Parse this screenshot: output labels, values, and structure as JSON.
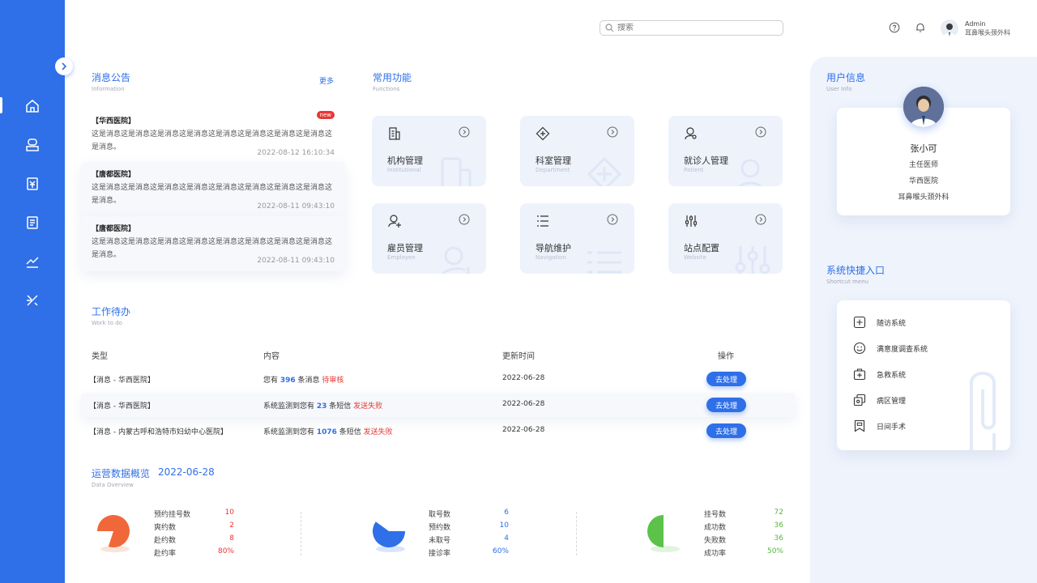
{
  "topbar": {
    "search_placeholder": "搜索",
    "admin_name": "Admin",
    "admin_dept": "耳鼻喉头颈外科"
  },
  "notices": {
    "title": "消息公告",
    "subtitle": "Information",
    "more": "更多",
    "items": [
      {
        "org": "【华西医院】",
        "body": "这是消息这是消息这是消息这是消息这是消息这是消息这是消息这是消息这是消息。",
        "time": "2022-08-12   16:10:34",
        "badge": "new"
      },
      {
        "org": "【唐都医院】",
        "body": "这是消息这是消息这是消息这是消息这是消息这是消息这是消息这是消息这是消息。",
        "time": "2022-08-11   09:43:10"
      },
      {
        "org": "【唐都医院】",
        "body": "这是消息这是消息这是消息这是消息这是消息这是消息这是消息这是消息这是消息。",
        "time": "2022-08-11   09:43:10"
      }
    ]
  },
  "functions": {
    "title": "常用功能",
    "subtitle": "Functions",
    "items": [
      {
        "name": "机构管理",
        "sub": "Institutional"
      },
      {
        "name": "科室管理",
        "sub": "Department"
      },
      {
        "name": "就诊人管理",
        "sub": "Patient"
      },
      {
        "name": "雇员管理",
        "sub": "Employee"
      },
      {
        "name": "导航维护",
        "sub": "Navigation"
      },
      {
        "name": "站点配置",
        "sub": "Website"
      }
    ]
  },
  "todo": {
    "title": "工作待办",
    "subtitle": "Work to do",
    "headers": [
      "类型",
      "内容",
      "更新时间",
      "操作"
    ],
    "rows": [
      {
        "type": "【消息 - 华西医院】",
        "pre": "您有 ",
        "num": "396",
        "mid": " 条消息 ",
        "status": "待审核",
        "date": "2022-06-28",
        "action": "去处理"
      },
      {
        "type": "【消息 - 华西医院】",
        "pre": "系统监测到您有 ",
        "num": "23",
        "mid": " 条短信 ",
        "status": "发送失败",
        "date": "2022-06-28",
        "action": "去处理"
      },
      {
        "type": "【消息 - 内蒙古呼和浩特市妇幼中心医院】",
        "pre": "系统监测到您有 ",
        "num": "1076",
        "mid": " 条短信 ",
        "status": "发送失败",
        "date": "2022-06-28",
        "action": "去处理"
      }
    ]
  },
  "overview": {
    "title": "运营数据概览",
    "date": "2022-06-28",
    "subtitle": "Data Overview",
    "groups": [
      {
        "color": "#f0683a",
        "fraction": 0.8,
        "stats": [
          {
            "label": "预约挂号数",
            "value": "10"
          },
          {
            "label": "爽约数",
            "value": "2"
          },
          {
            "label": "赴约数",
            "value": "8"
          },
          {
            "label": "赴约率",
            "value": "80%"
          }
        ]
      },
      {
        "color": "#2f6fe8",
        "fraction": 0.6,
        "stats": [
          {
            "label": "取号数",
            "value": "6"
          },
          {
            "label": "预约数",
            "value": "10"
          },
          {
            "label": "未取号",
            "value": "4"
          },
          {
            "label": "接诊率",
            "value": "60%"
          }
        ]
      },
      {
        "color": "#5cc24a",
        "fraction": 0.5,
        "stats": [
          {
            "label": "挂号数",
            "value": "72"
          },
          {
            "label": "成功数",
            "value": "36"
          },
          {
            "label": "失败数",
            "value": "36"
          },
          {
            "label": "成功率",
            "value": "50%"
          }
        ]
      }
    ]
  },
  "user": {
    "title": "用户信息",
    "subtitle": "User Info",
    "name": "张小可",
    "role": "主任医师",
    "hospital": "华西医院",
    "dept": "耳鼻喉头颈外科"
  },
  "shortcuts": {
    "title": "系统快捷入口",
    "subtitle": "Shortcut menu",
    "items": [
      {
        "label": "随访系统",
        "icon": "plus-square-icon"
      },
      {
        "label": "满意度调查系统",
        "icon": "smiley-icon"
      },
      {
        "label": "急救系统",
        "icon": "first-aid-kit-icon"
      },
      {
        "label": "病区管理",
        "icon": "ward-copy-icon"
      },
      {
        "label": "日间手术",
        "icon": "bookmark-icon"
      }
    ]
  },
  "colors": {
    "primary": "#2f6fe8",
    "danger": "#e53935",
    "orange": "#f0683a",
    "green": "#5cc24a",
    "panel": "#eef3fc"
  }
}
